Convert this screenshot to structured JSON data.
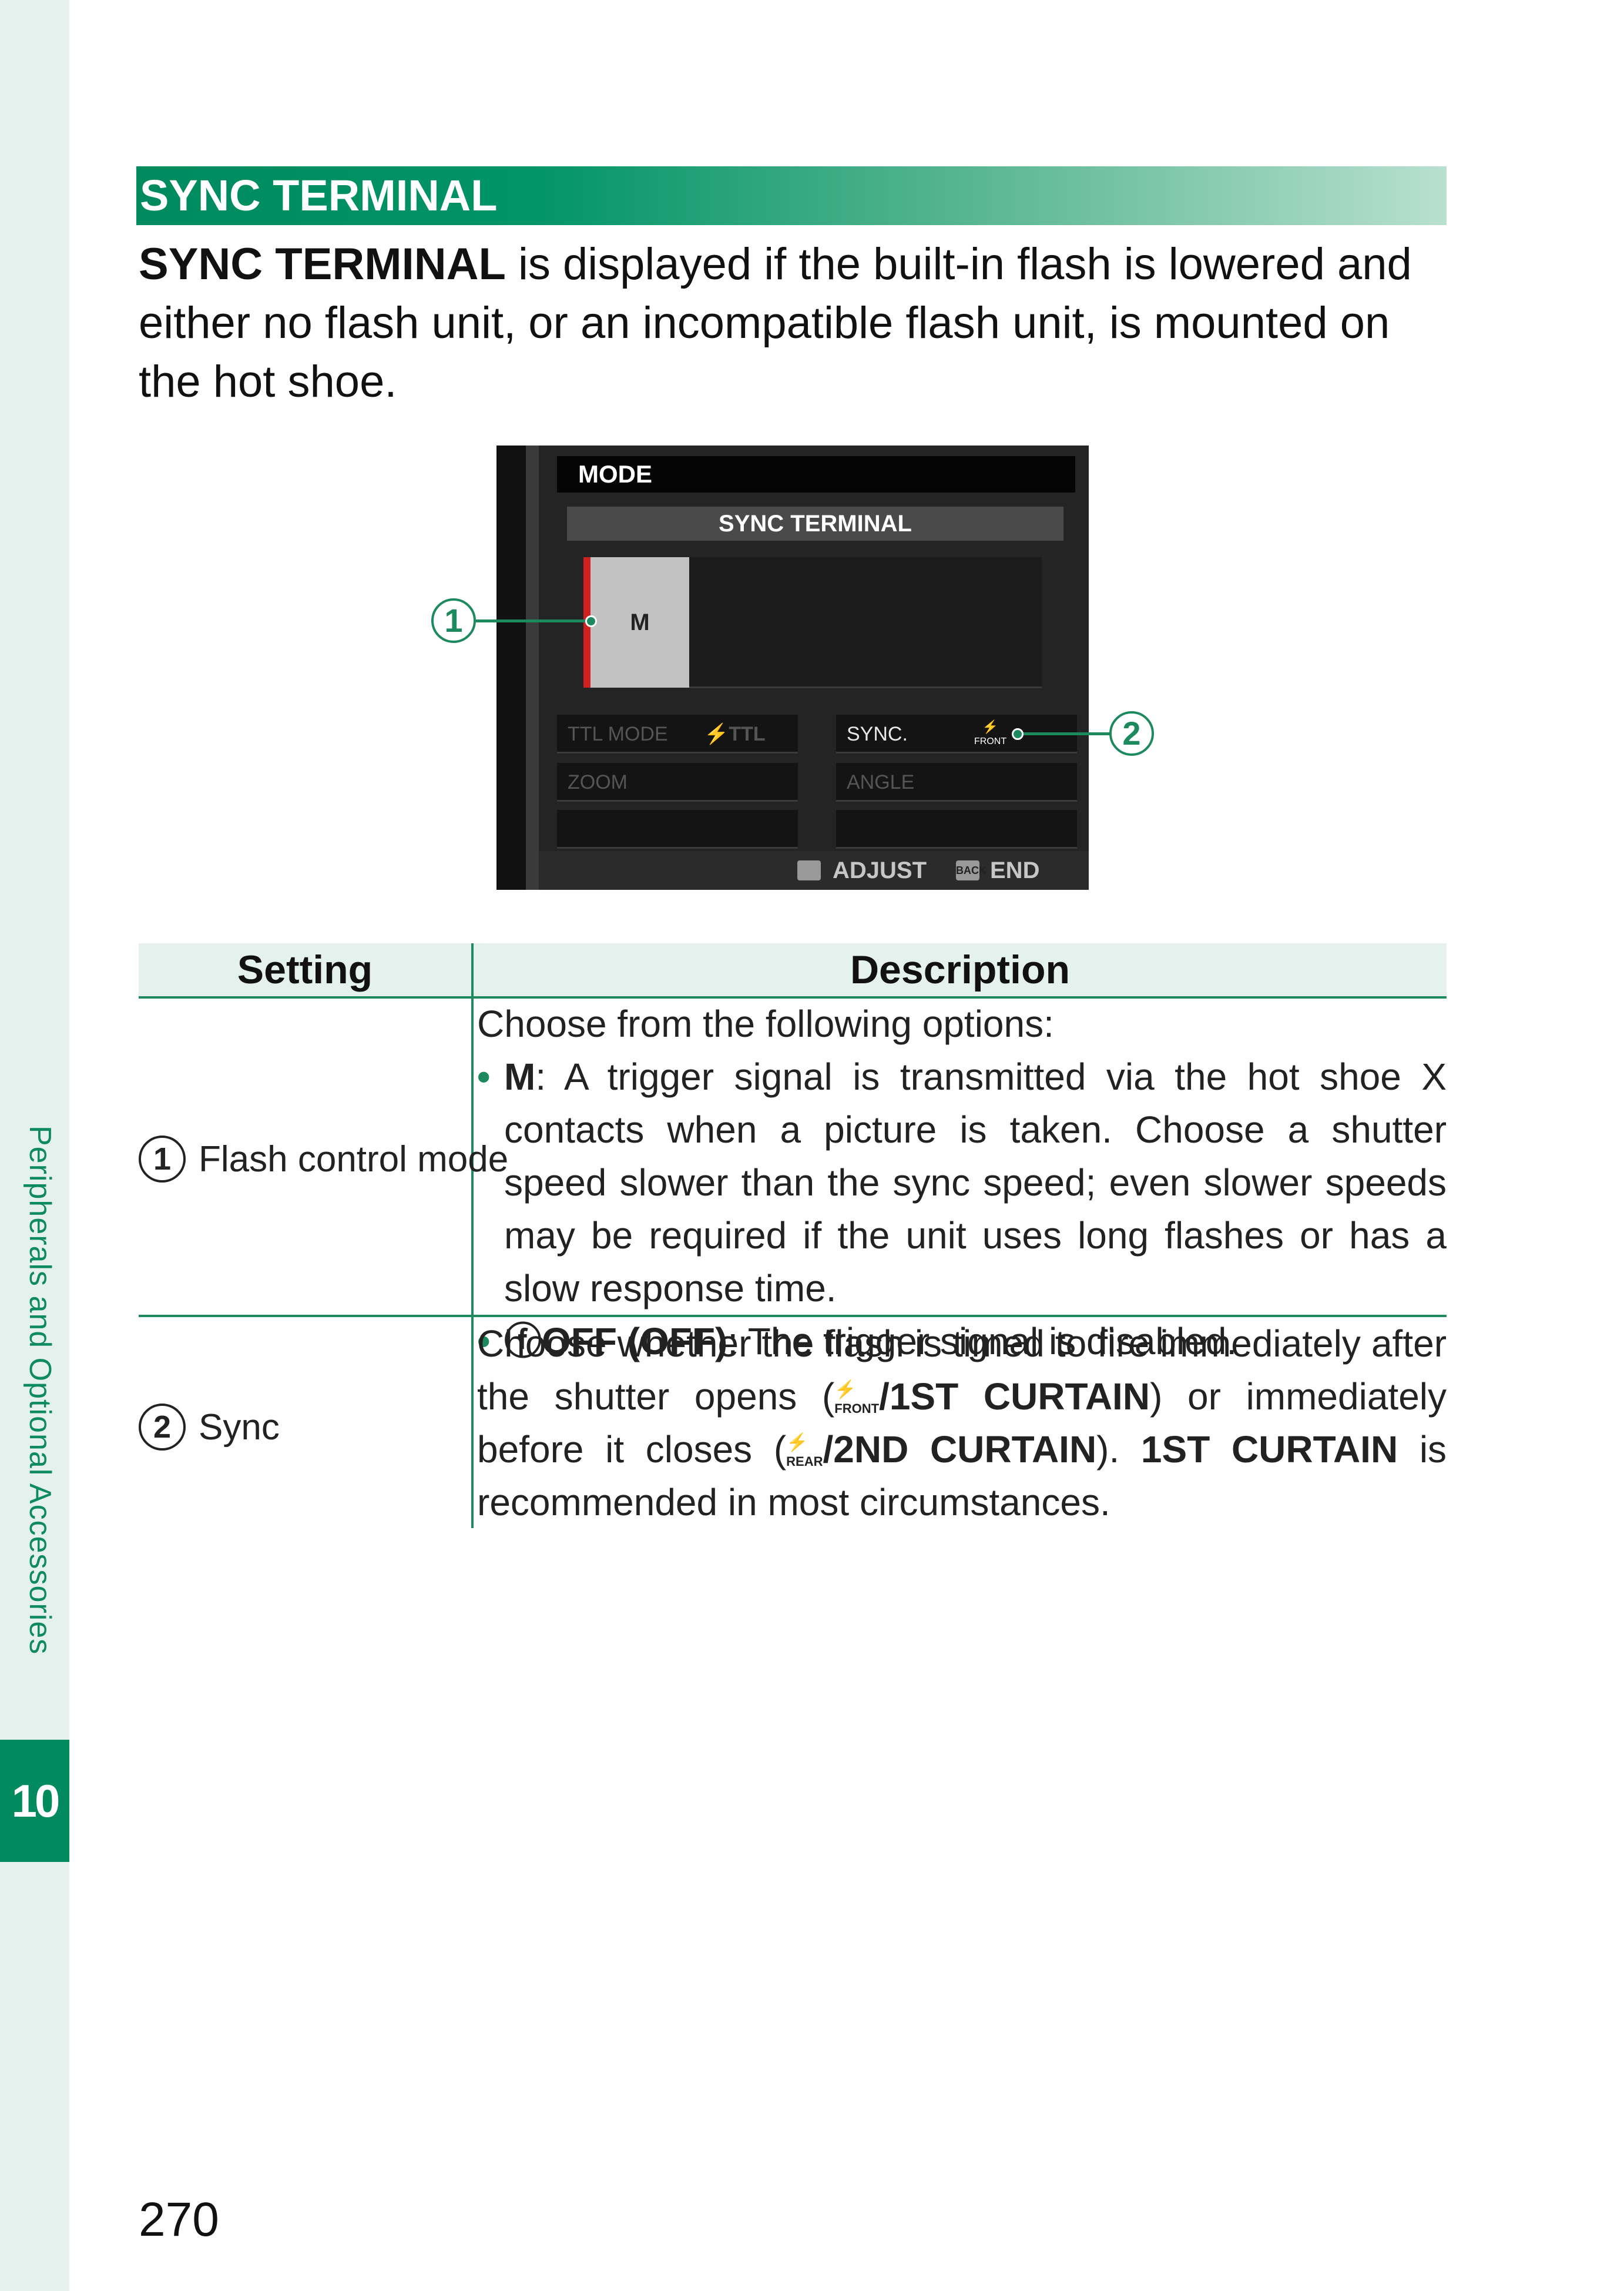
{
  "sidebar": {
    "section_label": "Peripherals and Optional Accessories",
    "chapter_number": "10"
  },
  "heading": "SYNC TERMINAL",
  "intro": {
    "lead_bold": "SYNC TERMINAL",
    "text": " is displayed if the built-in flash is lowered and either no flash unit, or an incompatible flash unit, is mounted on the hot shoe."
  },
  "screen": {
    "mode_label": "MODE",
    "title": "SYNC TERMINAL",
    "mode_value": "M",
    "cells": {
      "ttl_mode": "TTL MODE",
      "ttl_value": "⚡TTL",
      "sync": "SYNC.",
      "sync_value": "FRONT",
      "zoom": "ZOOM",
      "angle": "ANGLE"
    },
    "footer": {
      "adjust": "ADJUST",
      "back": "BACK",
      "end": "END"
    },
    "callouts": [
      "1",
      "2"
    ]
  },
  "table": {
    "headers": [
      "Setting",
      "Description"
    ],
    "rows": [
      {
        "num": "1",
        "setting": "Flash control mode",
        "intro": "Choose from the following options:",
        "bullet1_bold": "M",
        "bullet1_text": ": A trigger signal is transmitted via the hot shoe X contacts when a picture is taken. Choose a shutter speed slower than the sync speed; even slower speeds may be required if the unit uses long flashes or has a slow response time.",
        "bullet2_bold": "ⓕOFF (OFF)",
        "bullet2_text": ": The trigger signal is disabled."
      },
      {
        "num": "2",
        "setting": "Sync",
        "text_a": "Choose whether the flash is timed to fire immediately after the shutter opens (",
        "icon_front": "FRONT",
        "bold_a": "/1ST CURTAIN",
        "text_b": ") or immediately before it closes (",
        "icon_rear": "REAR",
        "bold_b": "/2ND CURTAIN",
        "text_c": "). ",
        "bold_c": "1ST CURTAIN",
        "text_d": " is recommended in most circumstances."
      }
    ]
  },
  "page_number": "270"
}
